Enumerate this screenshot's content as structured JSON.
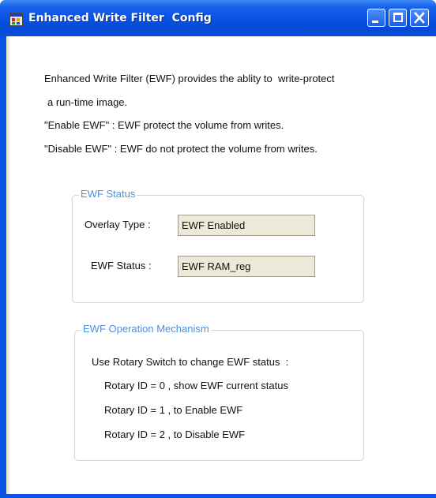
{
  "window": {
    "title": "Enhanced Write Filter  Config",
    "icon": "app-icon",
    "controls": [
      "minimize-icon",
      "maximize-icon",
      "close-icon"
    ],
    "colors": {
      "titlebar": "#0a54e6",
      "legend": "#4f8fd9",
      "field_bg": "#ece9d8"
    }
  },
  "description": {
    "line1": "Enhanced Write Filter (EWF) provides the ablity to  write-protect",
    "line2": "a run-time image.",
    "line3": "\"Enable EWF\" : EWF protect the volume from writes.",
    "line4": "\"Disable EWF\" : EWF do not protect the volume from writes."
  },
  "status_group": {
    "legend": "EWF Status",
    "overlay_label": "Overlay Type :",
    "overlay_value": "EWF Enabled",
    "status_label": "EWF Status :",
    "status_value": "EWF RAM_reg"
  },
  "mechanism_group": {
    "legend": "EWF Operation Mechanism",
    "intro": "Use Rotary Switch to change EWF status  :",
    "items": [
      "Rotary ID = 0 , show EWF current status",
      "Rotary ID = 1 , to Enable EWF",
      "Rotary ID = 2 , to Disable EWF"
    ]
  }
}
